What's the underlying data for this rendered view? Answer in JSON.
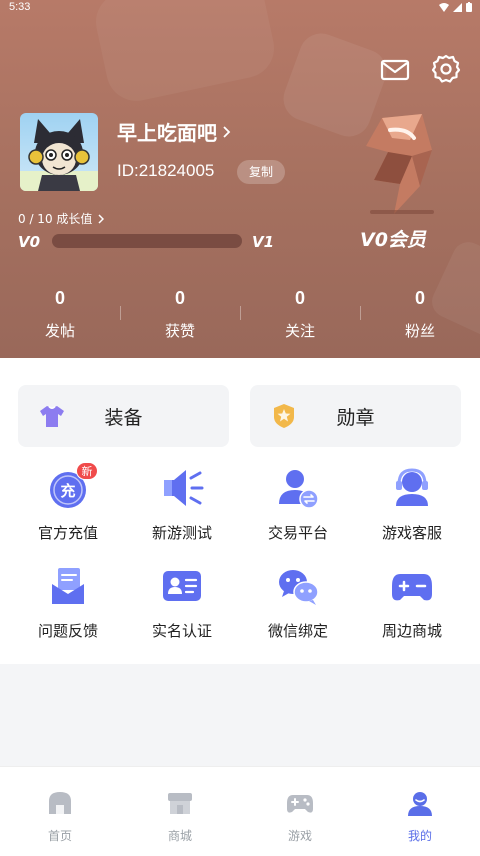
{
  "status_bar": {
    "time": "5:33"
  },
  "header": {
    "mail_icon": "mail-icon",
    "settings_icon": "gear-icon",
    "username": "早上吃面吧",
    "user_id": "ID:21824005",
    "copy_label": "复制",
    "growth_text": "0 / 10 成长值",
    "growth_progress": 0,
    "level_current": "V0",
    "level_next": "V1",
    "vip_label": "V0会员"
  },
  "stats": [
    {
      "value": "0",
      "label": "发帖"
    },
    {
      "value": "0",
      "label": "获赞"
    },
    {
      "value": "0",
      "label": "关注"
    },
    {
      "value": "0",
      "label": "粉丝"
    }
  ],
  "features": [
    {
      "label": "装备",
      "icon": "shirt-icon"
    },
    {
      "label": "勋章",
      "icon": "medal-icon"
    }
  ],
  "grid": [
    {
      "label": "官方充值",
      "icon": "recharge-icon",
      "badge": "新",
      "badge_glyph": "充"
    },
    {
      "label": "新游测试",
      "icon": "megaphone-icon"
    },
    {
      "label": "交易平台",
      "icon": "trade-user-icon"
    },
    {
      "label": "游戏客服",
      "icon": "headset-icon"
    },
    {
      "label": "问题反馈",
      "icon": "feedback-icon"
    },
    {
      "label": "实名认证",
      "icon": "id-card-icon"
    },
    {
      "label": "微信绑定",
      "icon": "wechat-icon"
    },
    {
      "label": "周边商城",
      "icon": "gamepad-shop-icon"
    }
  ],
  "tabbar": [
    {
      "label": "首页",
      "icon": "home-icon",
      "active": false
    },
    {
      "label": "商城",
      "icon": "store-icon",
      "active": false
    },
    {
      "label": "游戏",
      "icon": "gamepad-icon",
      "active": false
    },
    {
      "label": "我的",
      "icon": "profile-icon",
      "active": true
    }
  ],
  "colors": {
    "accent": "#5a6ee8",
    "header": "#a5705f",
    "badge_red": "#f04b4b"
  }
}
